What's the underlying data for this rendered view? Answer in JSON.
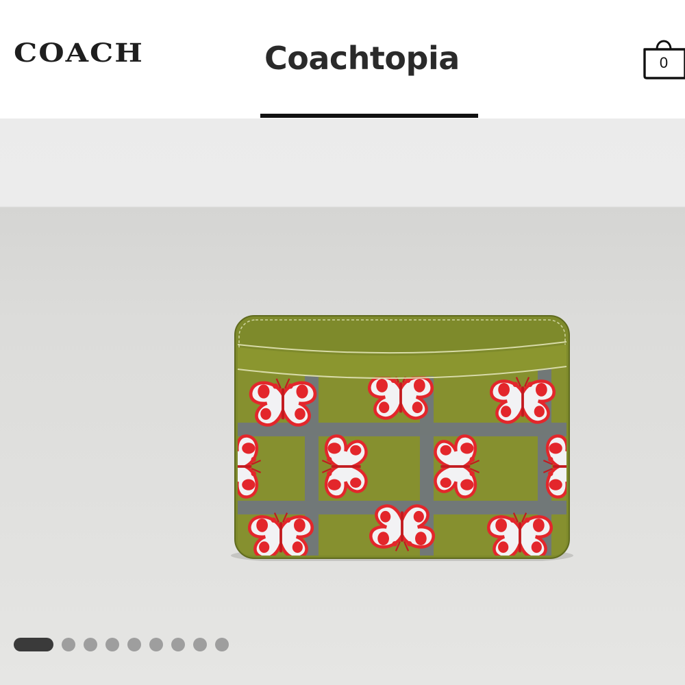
{
  "header": {
    "brand": "COACH",
    "tab_label": "Coachtopia",
    "cart_count": "0"
  },
  "carousel": {
    "active_index": 0,
    "slide_count": 9
  },
  "colors": {
    "leather": "#86902f",
    "print_red": "#e3262b",
    "active_dot": "#3a3a3a",
    "inactive_dot": "#9e9e9e"
  }
}
